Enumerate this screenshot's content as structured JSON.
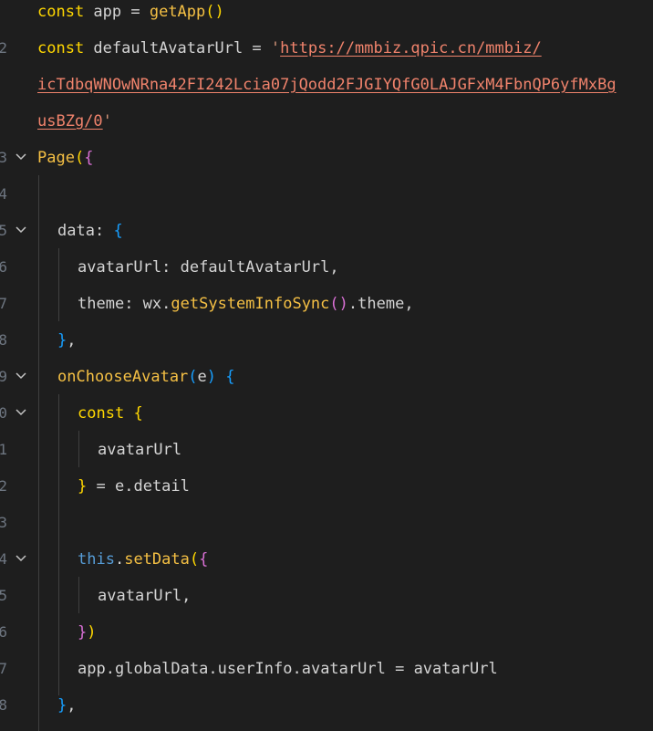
{
  "editor": {
    "lines": [
      {
        "num": "",
        "text": "const app = getApp()"
      },
      {
        "num": "2",
        "text": "const defaultAvatarUrl = 'https://mmbiz.qpic.cn/mmbiz/"
      },
      {
        "num": "",
        "text": "icTdbqWNOwNRna42FI242Lcia07jQodd2FJGIYQfG0LAJGFxM4FbnQP6yfMxBg"
      },
      {
        "num": "",
        "text": "usBZg/0'"
      },
      {
        "num": "3",
        "text": "Page({"
      },
      {
        "num": "4",
        "text": ""
      },
      {
        "num": "5",
        "text": "data: {"
      },
      {
        "num": "6",
        "text": "avatarUrl: defaultAvatarUrl,"
      },
      {
        "num": "7",
        "text": "theme: wx.getSystemInfoSync().theme,"
      },
      {
        "num": "8",
        "text": "},"
      },
      {
        "num": "9",
        "text": "onChooseAvatar(e) {"
      },
      {
        "num": "0",
        "text": "const {"
      },
      {
        "num": "1",
        "text": "avatarUrl"
      },
      {
        "num": "2",
        "text": "} = e.detail"
      },
      {
        "num": "3",
        "text": ""
      },
      {
        "num": "4",
        "text": "this.setData({"
      },
      {
        "num": "5",
        "text": "avatarUrl,"
      },
      {
        "num": "6",
        "text": "})"
      },
      {
        "num": "7",
        "text": "app.globalData.userInfo.avatarUrl = avatarUrl"
      },
      {
        "num": "8",
        "text": "},"
      }
    ],
    "tokens": {
      "l1": [
        "const",
        " app = ",
        "getApp",
        "()"
      ],
      "l2": [
        "const",
        " defaultAvatarUrl = ",
        "'",
        "https://mmbiz.qpic.cn/mmbiz/"
      ],
      "l3": [
        "icTdbqWNOwNRna42FI242Lcia07jQodd2FJGIYQfG0LAJGFxM4FbnQP6yfMxBg"
      ],
      "l4": [
        "usBZg/0",
        "'"
      ],
      "l5": [
        "Page",
        "(",
        "{"
      ],
      "l7": [
        "data",
        ": ",
        "{"
      ],
      "l8": [
        "avatarUrl",
        ": ",
        "defaultAvatarUrl",
        ","
      ],
      "l9": [
        "theme",
        ": ",
        "wx",
        ".",
        "getSystemInfoSync",
        "()",
        ".",
        "theme",
        ","
      ],
      "l10": [
        "}",
        ","
      ],
      "l11": [
        "onChooseAvatar",
        "(",
        "e",
        ")",
        " ",
        "{"
      ],
      "l12": [
        "const",
        " ",
        "{"
      ],
      "l13": [
        "avatarUrl"
      ],
      "l14": [
        "}",
        " = ",
        "e",
        ".",
        "detail"
      ],
      "l16": [
        "this",
        ".",
        "setData",
        "(",
        "{"
      ],
      "l17": [
        "avatarUrl",
        ","
      ],
      "l18": [
        "}",
        ")"
      ],
      "l19": [
        "app",
        ".",
        "globalData",
        ".",
        "userInfo",
        ".",
        "avatarUrl",
        " = ",
        "avatarUrl"
      ],
      "l20": [
        "}",
        ","
      ]
    }
  }
}
